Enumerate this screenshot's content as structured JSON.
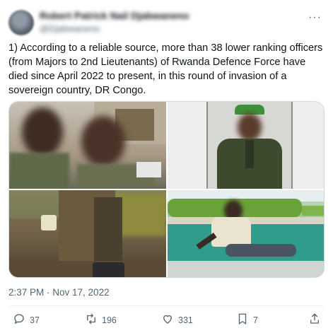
{
  "author": {
    "display_name": "Robert Patrick Nail Djabwaneno",
    "handle": "@Djabwaneno"
  },
  "tweet": {
    "text": "1) According to a reliable source, more than 38 lower ranking officers (from Majors to 2nd Lieutenants) of Rwanda Defence Force have died since April 2022 to present, in this round of invasion of a sovereign country, DR Congo.",
    "timestamp": "2:37 PM · Nov 17, 2022"
  },
  "media": {
    "photos": [
      "two-soldiers-selfie",
      "officer-portrait",
      "soldiers-at-night",
      "man-by-pool"
    ]
  },
  "actions": {
    "replies": "37",
    "retweets": "196",
    "likes": "331",
    "bookmarks": "7"
  },
  "icons": {
    "more": "more-horizontal-icon",
    "reply": "reply-icon",
    "retweet": "retweet-icon",
    "like": "heart-icon",
    "bookmark": "bookmark-icon",
    "share": "share-icon"
  },
  "colors": {
    "text": "#0f1419",
    "muted": "#536471",
    "border": "#cfd9de"
  }
}
